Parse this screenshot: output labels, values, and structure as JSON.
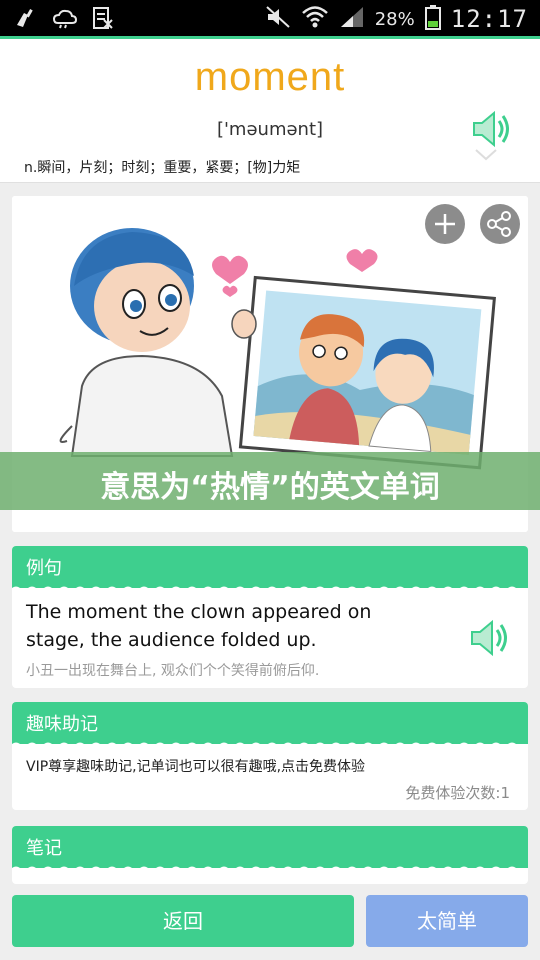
{
  "status_bar": {
    "battery_text": "28%",
    "time": "12:17"
  },
  "word": {
    "text": "moment",
    "phonetic": "['məumənt]",
    "definition": "n.瞬间，片刻；时刻；重要，紧要；[物]力矩"
  },
  "banner": {
    "text": "意思为“热情”的英文单词"
  },
  "example": {
    "title": "例句",
    "english": "The moment the clown appeared on stage, the audience folded up.",
    "chinese": "小丑一出现在舞台上, 观众们个个笑得前俯后仰."
  },
  "mnemonic": {
    "title": "趣味助记",
    "text": "VIP尊享趣味助记,记单词也可以很有趣哦,点击免费体验",
    "trial_count": "免费体验次数:1"
  },
  "notes": {
    "title": "笔记"
  },
  "buttons": {
    "back": "返回",
    "too_easy": "太简单"
  },
  "colors": {
    "accent_green": "#3ecf8e",
    "word_orange": "#f0a81b",
    "easy_blue": "#86aaea"
  }
}
